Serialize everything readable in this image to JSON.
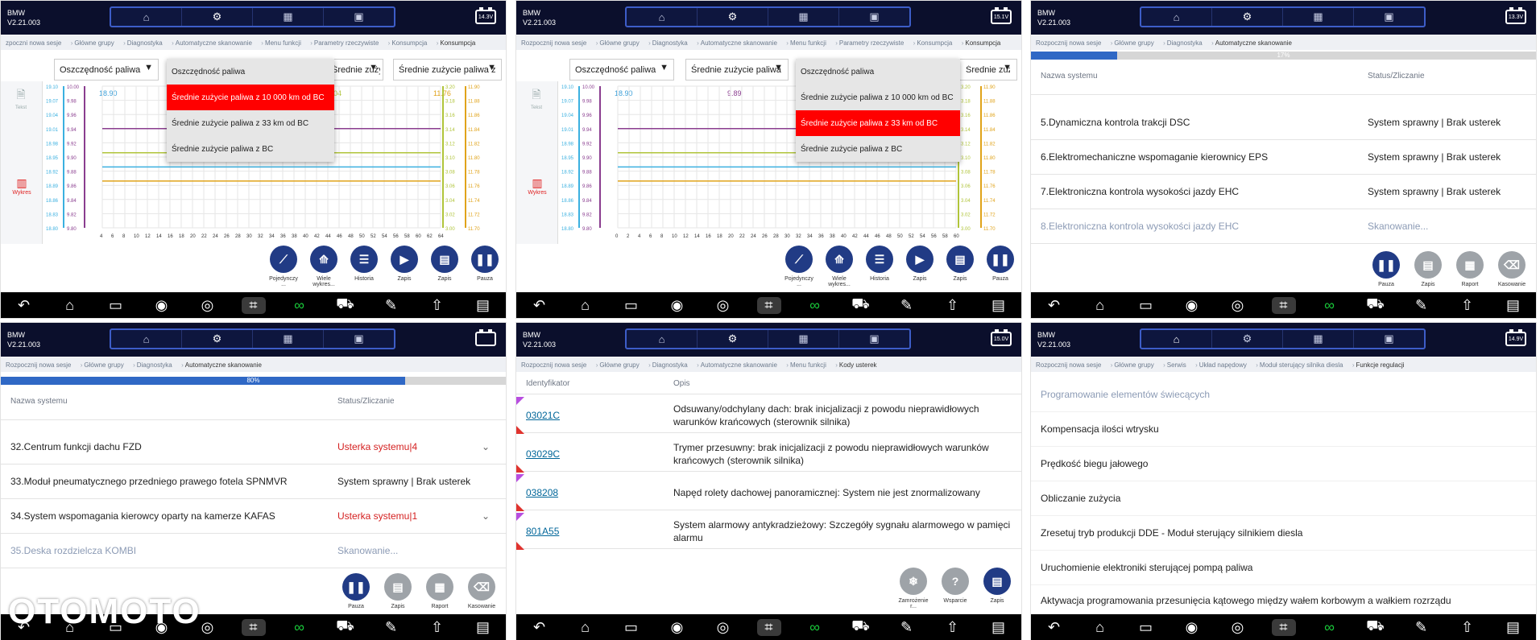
{
  "brand": "BMW",
  "version": "V2.21.003",
  "tabs": [
    "home-icon",
    "settings-icon",
    "car-garage-icon",
    "picture-icon"
  ],
  "nav": [
    "back-icon",
    "home-icon",
    "window-icon",
    "camera-icon",
    "planet-icon",
    "crop-icon",
    "link-icon",
    "car-icon",
    "wrench-icon",
    "upload-icon",
    "book-icon"
  ],
  "p1": {
    "battery": "14.3V",
    "crumbs": [
      "zpoczni nowa sesje",
      "Główne grupy",
      "Diagnostyka",
      "Automatyczne skanowanie",
      "Menu funkcji",
      "Parametry rzeczywiste",
      "Konsumpcja",
      "Konsumpcja"
    ],
    "dd1": "Oszczędność paliwa",
    "dd2": "Średnie zużycie paliwa z",
    "dd3": "Średnie zużycie paliwa z",
    "menu": [
      "Oszczędność paliwa",
      "Średnie zużycie paliwa z 10 000 km od BC",
      "Średnie zużycie paliwa z 33 km od BC",
      "Średnie zużycie paliwa z BC"
    ],
    "side_text": "Tekst",
    "side_chart": "Wykres",
    "val1": "18.90",
    "val2": "11.76",
    "val3": "04",
    "actions": [
      "Pojedynczy ...",
      "Wiele wykres...",
      "Historia",
      "Zapis",
      "Zapis",
      "Pauza"
    ]
  },
  "p2": {
    "battery": "15.1V",
    "crumbs": [
      "Rozpocznij nowa sesje",
      "Główne grupy",
      "Diagnostyka",
      "Automatyczne skanowanie",
      "Menu funkcji",
      "Parametry rzeczywiste",
      "Konsumpcja",
      "Konsumpcja"
    ],
    "dd1": "Oszczędność paliwa",
    "dd2": "Średnie zużycie paliwa",
    "dd3": "Średnie zużycie paliwa z",
    "menu": [
      "Oszczędność paliwa",
      "Średnie zużycie paliwa z 10 000 km od BC",
      "Średnie zużycie paliwa z 33 km od BC",
      "Średnie zużycie paliwa z BC"
    ],
    "side_text": "Tekst",
    "side_chart": "Wykres",
    "val1": "18.90",
    "val2": "9.89",
    "val3": "76",
    "actions": [
      "Pojedynczy ...",
      "Wiele wykres...",
      "Historia",
      "Zapis",
      "Zapis",
      "Pauza"
    ]
  },
  "p3": {
    "battery": "13.3V",
    "crumbs": [
      "Rozpocznij nowa sesje",
      "Główne grupy",
      "Diagnostyka",
      "Automatyczne skanowanie"
    ],
    "progress_label": "17%",
    "progress": 0.17,
    "hdr_name": "Nazwa systemu",
    "hdr_status": "Status/Zliczanie",
    "rows": [
      {
        "n": "5.Dynamiczna kontrola trakcji DSC",
        "s": "System sprawny | Brak usterek"
      },
      {
        "n": "6.Elektromechaniczne wspomaganie kierownicy EPS",
        "s": "System sprawny | Brak usterek"
      },
      {
        "n": "7.Elektroniczna kontrola wysokości jazdy EHC",
        "s": "System sprawny | Brak usterek"
      },
      {
        "n": "8.Elektroniczna kontrola wysokości jazdy EHC",
        "s": "Skanowanie..."
      }
    ],
    "actions": [
      "Pauza",
      "Zapis",
      "Raport",
      "Kasowanie"
    ]
  },
  "p4": {
    "battery": "",
    "crumbs": [
      "Rozpocznij nowa sesje",
      "Główne grupy",
      "Diagnostyka",
      "Automatyczne skanowanie"
    ],
    "progress_label": "80%",
    "progress": 0.8,
    "hdr_name": "Nazwa systemu",
    "hdr_status": "Status/Zliczanie",
    "rows": [
      {
        "n": "32.Centrum funkcji dachu FZD",
        "s": "Usterka systemu|4"
      },
      {
        "n": "33.Moduł pneumatycznego przedniego prawego fotela SPNMVR",
        "s": "System sprawny | Brak usterek"
      },
      {
        "n": "34.System wspomagania kierowcy oparty na kamerze KAFAS",
        "s": "Usterka systemu|1"
      },
      {
        "n": "35.Deska rozdzielcza KOMBI",
        "s": "Skanowanie..."
      }
    ],
    "actions": [
      "Pauza",
      "Zapis",
      "Raport",
      "Kasowanie"
    ],
    "watermark": "OTOMOTO"
  },
  "p5": {
    "battery": "15.0V",
    "crumbs": [
      "Rozpocznij nowa sesje",
      "Główne grupy",
      "Diagnostyka",
      "Automatyczne skanowanie",
      "Menu funkcji",
      "Kody usterek"
    ],
    "hdr_id": "Identyfikator",
    "hdr_desc": "Opis",
    "codes": [
      {
        "id": "03021C",
        "d": "Odsuwany/odchylany dach: brak inicjalizacji z powodu nieprawidłowych warunków krańcowych (sterownik silnika)"
      },
      {
        "id": "03029C",
        "d": "Trymer przesuwny: brak inicjalizacji z powodu nieprawidłowych warunków krańcowych (sterownik silnika)"
      },
      {
        "id": "038208",
        "d": "Napęd rolety dachowej panoramicznej: System nie jest znormalizowany"
      },
      {
        "id": "801A55",
        "d": "System alarmowy antykradzieżowy: Szczegóły sygnału alarmowego w pamięci alarmu"
      }
    ],
    "actions": [
      "Zamrożenie r...",
      "Wsparcie",
      "Zapis"
    ]
  },
  "p6": {
    "battery": "14.9V",
    "crumbs": [
      "Rozpocznij nowa sesje",
      "Główne grupy",
      "Serwis",
      "Układ napędowy",
      "Moduł sterujący silnika diesla",
      "Funkcje regulacji"
    ],
    "functions": [
      "Programowanie elementów świecących",
      "Kompensacja ilości wtrysku",
      "Prędkość biegu jałowego",
      "Obliczanie zużycia",
      "Zresetuj tryb produkcji DDE - Moduł sterujący silnikiem diesla",
      "Uruchomienie elektroniki sterującej pompą paliwa",
      "Aktywacja programowania przesunięcia kątowego między wałem korbowym a wałkiem rozrządu"
    ]
  },
  "chart_data": [
    {
      "type": "line",
      "x": [
        4,
        6,
        8,
        10,
        12,
        14,
        16,
        18,
        20,
        22,
        24,
        26,
        28,
        30,
        32,
        34,
        36,
        38,
        40,
        42,
        44,
        46,
        48,
        50,
        52,
        54,
        56,
        58,
        60,
        62,
        64
      ],
      "left_axes": [
        [
          "19.10",
          "19.07",
          "19.04",
          "19.01",
          "18.98",
          "18.95",
          "18.92",
          "18.89",
          "18.86",
          "18.83",
          "18.80"
        ],
        [
          "10.00",
          "9.98",
          "9.96",
          "9.94",
          "9.92",
          "9.90",
          "9.88",
          "9.86",
          "9.84",
          "9.82",
          "9.80"
        ]
      ],
      "right_axes": [
        [
          "3.20",
          "3.18",
          "3.16",
          "3.14",
          "3.12",
          "3.10",
          "3.08",
          "3.06",
          "3.04",
          "3.02",
          "3.00"
        ],
        [
          "11.90",
          "11.88",
          "11.86",
          "11.84",
          "11.82",
          "11.80",
          "11.78",
          "11.76",
          "11.74",
          "11.72",
          "11.70"
        ]
      ],
      "series": [
        {
          "color": "#8a3d8f",
          "level": 0.3
        },
        {
          "color": "#3bb0e0",
          "level": 0.57
        },
        {
          "color": "#b0c43a",
          "level": 0.47
        },
        {
          "color": "#e0a31a",
          "level": 0.67
        }
      ]
    },
    {
      "type": "line",
      "x": [
        0,
        2,
        4,
        6,
        8,
        10,
        12,
        14,
        16,
        18,
        20,
        22,
        24,
        26,
        28,
        30,
        32,
        34,
        36,
        38,
        40,
        42,
        44,
        46,
        48,
        50,
        52,
        54,
        56,
        58,
        60
      ],
      "left_axes": [
        [
          "19.10",
          "19.07",
          "19.04",
          "19.01",
          "18.98",
          "18.95",
          "18.92",
          "18.89",
          "18.86",
          "18.83",
          "18.80"
        ],
        [
          "10.00",
          "9.98",
          "9.96",
          "9.94",
          "9.92",
          "9.90",
          "9.88",
          "9.86",
          "9.84",
          "9.82",
          "9.80"
        ]
      ],
      "right_axes": [
        [
          "3.20",
          "3.18",
          "3.16",
          "3.14",
          "3.12",
          "3.10",
          "3.08",
          "3.06",
          "3.04",
          "3.02",
          "3.00"
        ],
        [
          "11.90",
          "11.88",
          "11.86",
          "11.84",
          "11.82",
          "11.80",
          "11.78",
          "11.76",
          "11.74",
          "11.72",
          "11.70"
        ]
      ],
      "series": [
        {
          "color": "#8a3d8f",
          "level": 0.3
        },
        {
          "color": "#3bb0e0",
          "level": 0.57
        },
        {
          "color": "#b0c43a",
          "level": 0.47
        },
        {
          "color": "#e0a31a",
          "level": 0.67
        }
      ]
    }
  ]
}
